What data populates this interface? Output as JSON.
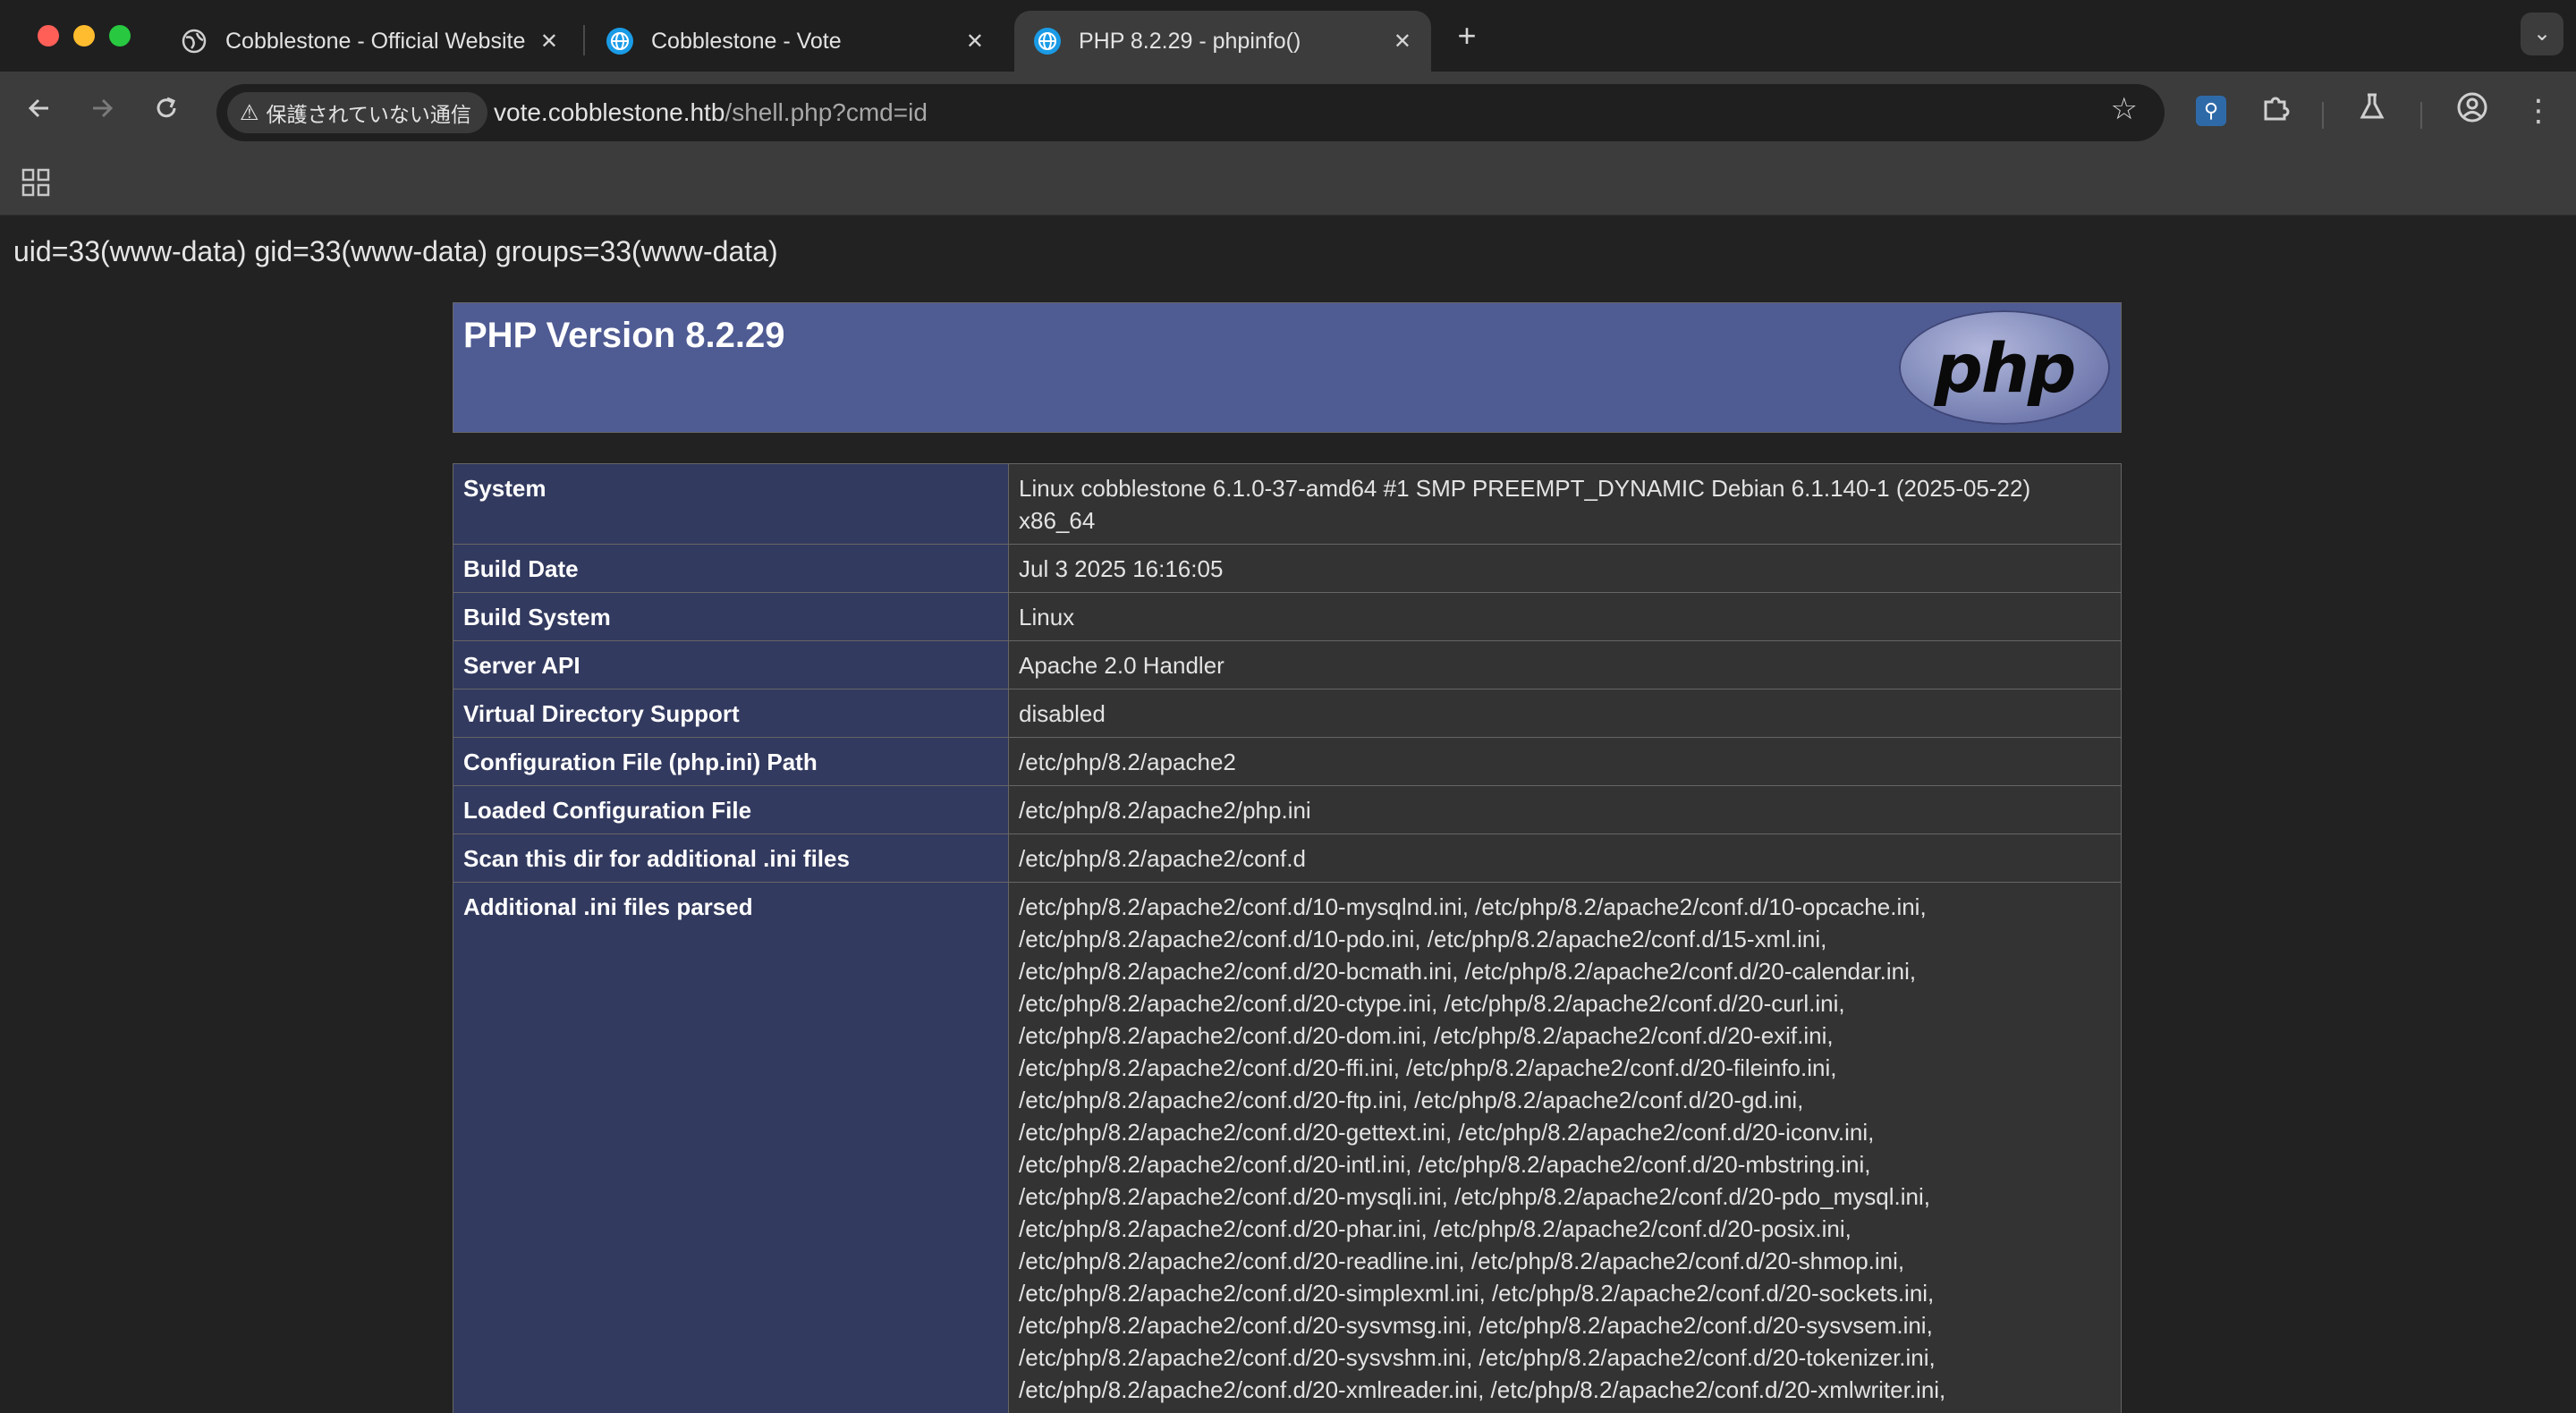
{
  "browser": {
    "tabs": [
      {
        "title": "Cobblestone - Official Website",
        "favicon": "globe-icon",
        "active": false
      },
      {
        "title": "Cobblestone - Vote",
        "favicon": "globe-icon",
        "active": false
      },
      {
        "title": "PHP 8.2.29 - phpinfo()",
        "favicon": "globe-icon",
        "active": true
      }
    ],
    "new_tab_label": "+",
    "security_label": "保護されていない通信",
    "url_host": "vote.cobblestone.htb",
    "url_path": "/shell.php?cmd=id"
  },
  "page": {
    "command_output": "uid=33(www-data) gid=33(www-data) groups=33(www-data)",
    "php_version_title": "PHP Version 8.2.29",
    "logo_text": "php",
    "info_rows": [
      {
        "key": "System",
        "value": "Linux cobblestone 6.1.0-37-amd64 #1 SMP PREEMPT_DYNAMIC Debian 6.1.140-1 (2025-05-22) x86_64"
      },
      {
        "key": "Build Date",
        "value": "Jul 3 2025 16:16:05"
      },
      {
        "key": "Build System",
        "value": "Linux"
      },
      {
        "key": "Server API",
        "value": "Apache 2.0 Handler"
      },
      {
        "key": "Virtual Directory Support",
        "value": "disabled"
      },
      {
        "key": "Configuration File (php.ini) Path",
        "value": "/etc/php/8.2/apache2"
      },
      {
        "key": "Loaded Configuration File",
        "value": "/etc/php/8.2/apache2/php.ini"
      },
      {
        "key": "Scan this dir for additional .ini files",
        "value": "/etc/php/8.2/apache2/conf.d"
      },
      {
        "key": "Additional .ini files parsed",
        "value": "/etc/php/8.2/apache2/conf.d/10-mysqlnd.ini, /etc/php/8.2/apache2/conf.d/10-opcache.ini, /etc/php/8.2/apache2/conf.d/10-pdo.ini, /etc/php/8.2/apache2/conf.d/15-xml.ini, /etc/php/8.2/apache2/conf.d/20-bcmath.ini, /etc/php/8.2/apache2/conf.d/20-calendar.ini, /etc/php/8.2/apache2/conf.d/20-ctype.ini, /etc/php/8.2/apache2/conf.d/20-curl.ini, /etc/php/8.2/apache2/conf.d/20-dom.ini, /etc/php/8.2/apache2/conf.d/20-exif.ini, /etc/php/8.2/apache2/conf.d/20-ffi.ini, /etc/php/8.2/apache2/conf.d/20-fileinfo.ini, /etc/php/8.2/apache2/conf.d/20-ftp.ini, /etc/php/8.2/apache2/conf.d/20-gd.ini, /etc/php/8.2/apache2/conf.d/20-gettext.ini, /etc/php/8.2/apache2/conf.d/20-iconv.ini, /etc/php/8.2/apache2/conf.d/20-intl.ini, /etc/php/8.2/apache2/conf.d/20-mbstring.ini, /etc/php/8.2/apache2/conf.d/20-mysqli.ini, /etc/php/8.2/apache2/conf.d/20-pdo_mysql.ini, /etc/php/8.2/apache2/conf.d/20-phar.ini, /etc/php/8.2/apache2/conf.d/20-posix.ini, /etc/php/8.2/apache2/conf.d/20-readline.ini, /etc/php/8.2/apache2/conf.d/20-shmop.ini, /etc/php/8.2/apache2/conf.d/20-simplexml.ini, /etc/php/8.2/apache2/conf.d/20-sockets.ini, /etc/php/8.2/apache2/conf.d/20-sysvmsg.ini, /etc/php/8.2/apache2/conf.d/20-sysvsem.ini, /etc/php/8.2/apache2/conf.d/20-sysvshm.ini, /etc/php/8.2/apache2/conf.d/20-tokenizer.ini, /etc/php/8.2/apache2/conf.d/20-xmlreader.ini, /etc/php/8.2/apache2/conf.d/20-xmlwriter.ini,"
      }
    ]
  },
  "colors": {
    "php_header": "#4f5b93",
    "key_cell": "#333a5f",
    "value_cell": "#333333",
    "page_bg": "#222222"
  }
}
